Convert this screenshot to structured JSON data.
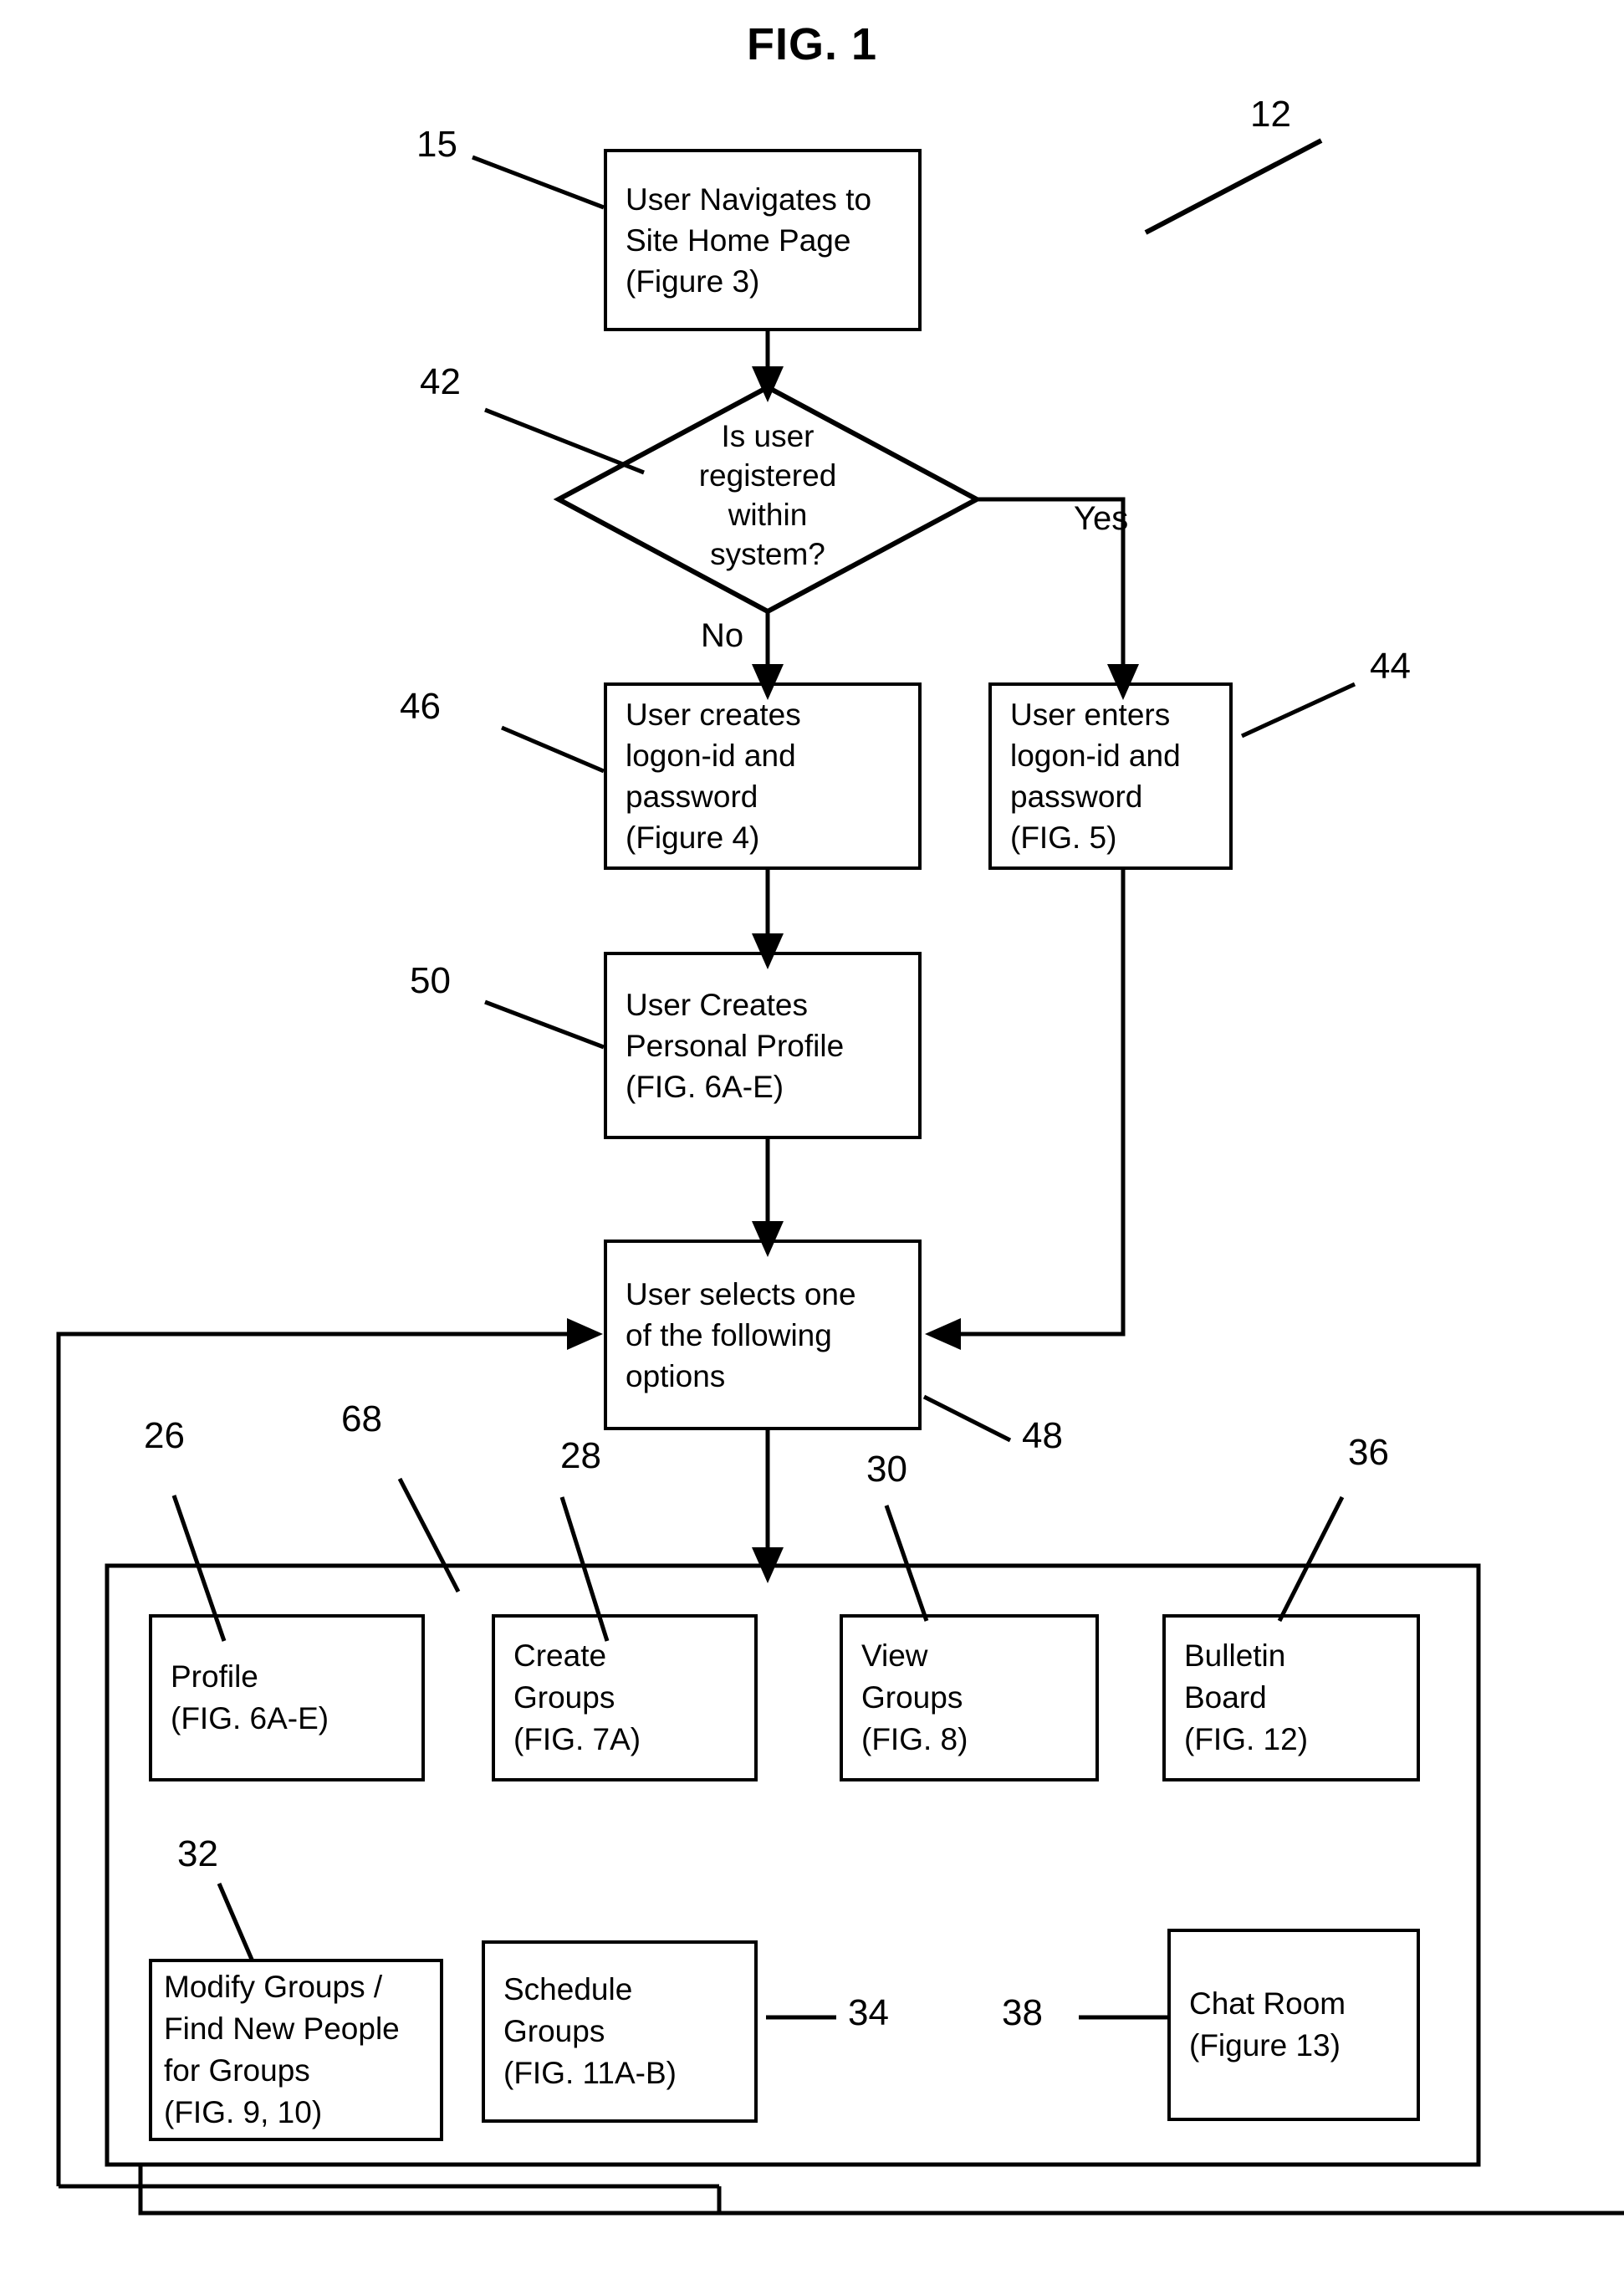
{
  "figure": {
    "title": "FIG. 1",
    "diagram_ref": "12"
  },
  "nodes": {
    "start": {
      "ref": "15",
      "lines": [
        "User Navigates to",
        "Site Home Page",
        "(Figure 3)"
      ]
    },
    "decision": {
      "ref": "42",
      "lines": [
        "Is user",
        "registered",
        "within",
        "system?"
      ],
      "yes_label": "Yes",
      "no_label": "No"
    },
    "create_logon": {
      "ref": "46",
      "lines": [
        "User creates",
        "logon-id and",
        "password",
        "(Figure 4)"
      ]
    },
    "enter_logon": {
      "ref": "44",
      "lines": [
        "User enters",
        "logon-id and",
        "password",
        "(FIG. 5)"
      ]
    },
    "create_profile": {
      "ref": "50",
      "lines": [
        "User Creates",
        "Personal Profile",
        "(FIG. 6A-E)"
      ]
    },
    "select_options": {
      "ref": "48",
      "lines": [
        "User selects one",
        "of the following",
        "options"
      ]
    }
  },
  "options_panel": {
    "ref": "68",
    "items": [
      {
        "ref": "26",
        "lines": [
          "Profile",
          "(FIG. 6A-E)"
        ]
      },
      {
        "ref": "28",
        "lines": [
          "Create",
          "Groups",
          "(FIG. 7A)"
        ]
      },
      {
        "ref": "30",
        "lines": [
          "View",
          "Groups",
          "(FIG. 8)"
        ]
      },
      {
        "ref": "36",
        "lines": [
          "Bulletin",
          "Board",
          "(FIG. 12)"
        ]
      },
      {
        "ref": "32",
        "lines": [
          "Modify Groups /",
          "Find New People",
          "for Groups",
          "(FIG. 9, 10)"
        ]
      },
      {
        "ref": "34",
        "lines": [
          "Schedule",
          "Groups",
          "(FIG. 11A-B)"
        ]
      },
      {
        "ref": "38",
        "lines": [
          "Chat Room",
          "(Figure 13)"
        ]
      }
    ]
  },
  "colors": {
    "stroke": "#000000",
    "background": "#ffffff"
  }
}
